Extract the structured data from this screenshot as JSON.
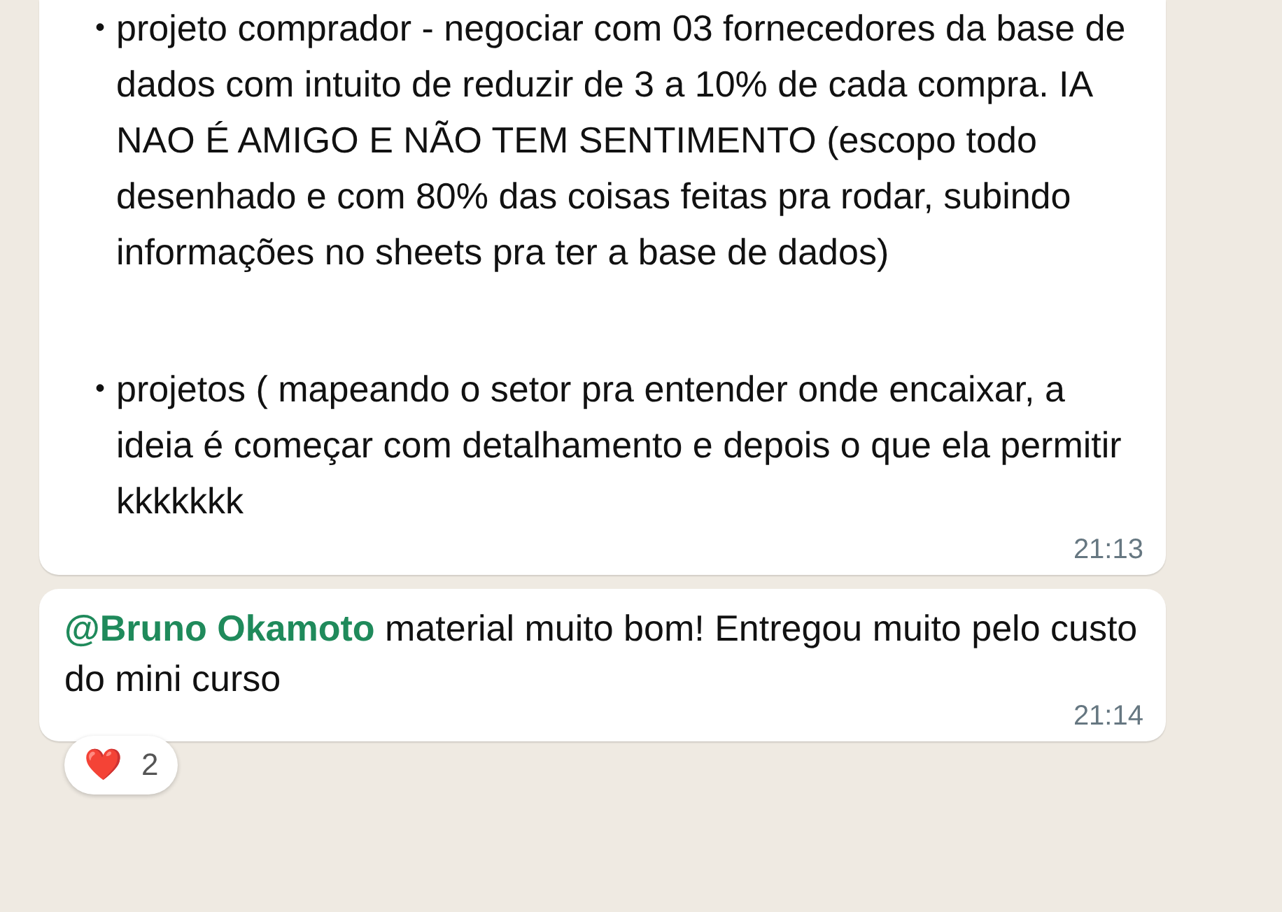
{
  "messages": [
    {
      "kind": "bullets",
      "items": [
        {
          "bullet": "•",
          "text": "projeto comprador - negociar com 03 fornecedores da base de dados com intuito de reduzir de 3 a 10% de cada compra. IA NAO É AMIGO E NÃO TEM SENTIMENTO (escopo todo desenhado e com 80% das coisas feitas pra rodar, subindo informações no sheets pra ter a base de dados)"
        },
        {
          "bullet": "•",
          "text": "projetos ( mapeando o setor pra entender onde encaixar, a ideia é começar com detalhamento e depois o que ela permitir kkkkkkk"
        }
      ],
      "time": "21:13"
    },
    {
      "kind": "mention",
      "mention": "@Bruno Okamoto",
      "text": "material muito bom! Entregou muito pelo custo do mini curso",
      "time": "21:14",
      "reaction": {
        "emoji": "❤️",
        "count": "2"
      }
    }
  ]
}
